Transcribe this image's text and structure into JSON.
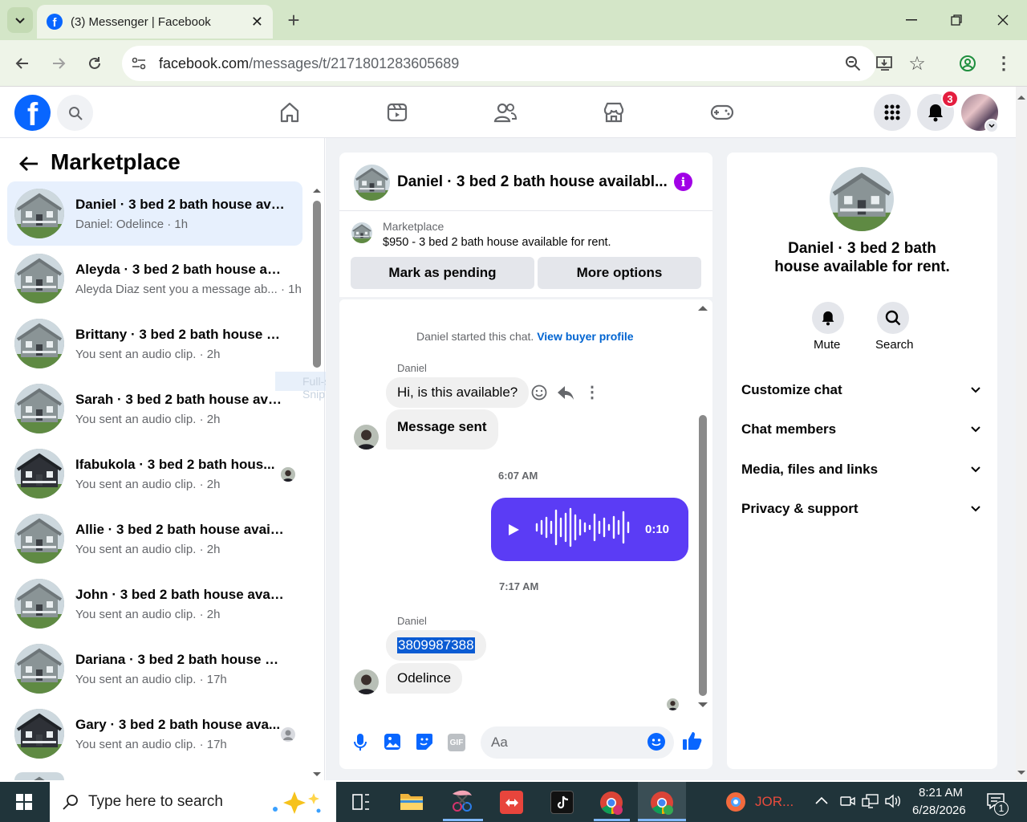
{
  "browser": {
    "tab_title": "(3) Messenger | Facebook",
    "url_domain": "facebook.com",
    "url_path": "/messages/t/2171801283605689"
  },
  "fb": {
    "notification_count": "3"
  },
  "sidebar": {
    "title": "Marketplace",
    "conversations": [
      {
        "name": "Daniel · 3 bed 2 bath house avai...",
        "snippet": "Daniel: Odelince · 1h",
        "active": true
      },
      {
        "name": "Aleyda · 3 bed 2 bath house ava...",
        "snippet": "Aleyda Diaz sent you a message ab... · 1h"
      },
      {
        "name": "Brittany · 3 bed 2 bath house av...",
        "snippet": "You sent an audio clip. · 2h"
      },
      {
        "name": "Sarah · 3 bed 2 bath house avail...",
        "snippet": "You sent an audio clip. · 2h"
      },
      {
        "name": "Ifabukola · 3 bed 2 bath hous...",
        "snippet": "You sent an audio clip. · 2h"
      },
      {
        "name": "Allie · 3 bed 2 bath house availa...",
        "snippet": "You sent an audio clip. · 2h"
      },
      {
        "name": "John · 3 bed 2 bath house availa...",
        "snippet": "You sent an audio clip. · 2h"
      },
      {
        "name": "Dariana · 3 bed 2 bath house av...",
        "snippet": "You sent an audio clip. · 17h"
      },
      {
        "name": "Gary · 3 bed 2 bath house ava...",
        "snippet": "You sent an audio clip. · 17h"
      }
    ],
    "snip_watermark": "Full-screen Snip"
  },
  "chat": {
    "header_title": "Daniel · 3 bed 2 bath house availabl...",
    "listing_label": "Marketplace",
    "listing_title": "$950 - 3 bed 2 bath house available for rent.",
    "mark_pending": "Mark as pending",
    "more_options": "More options",
    "started_text": "Daniel started this chat.",
    "buyer_profile_link": "View buyer profile",
    "sender1": "Daniel",
    "msg1": "Hi, is this available?",
    "msg2": "Message sent",
    "time1": "6:07 AM",
    "audio_duration": "0:10",
    "time2": "7:17 AM",
    "sender2": "Daniel",
    "msg3": "3809987388",
    "msg4": "Odelince",
    "composer_placeholder": "Aa"
  },
  "info": {
    "title": "Daniel · 3 bed 2 bath house available for rent.",
    "mute": "Mute",
    "search": "Search",
    "sections": [
      "Customize chat",
      "Chat members",
      "Media, files and links",
      "Privacy & support"
    ]
  },
  "taskbar": {
    "search_placeholder": "Type here to search",
    "app_label": "JOR...",
    "time": "8:21 AM",
    "date": "6/28/2026",
    "notif_count": "1"
  },
  "colors": {
    "fb_blue": "#0866ff",
    "messenger_purple": "#5b3cf5",
    "accent_link": "#0064d1"
  }
}
